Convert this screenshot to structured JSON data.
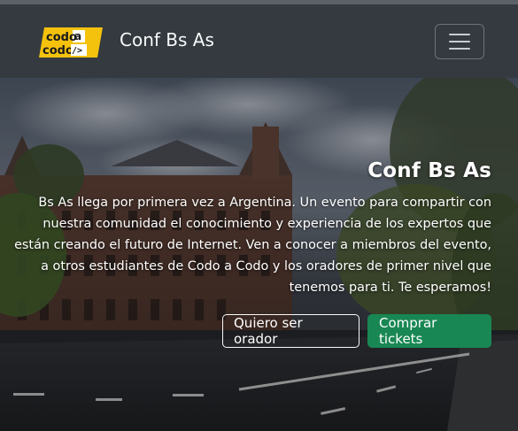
{
  "navbar": {
    "logo_line1": "codo",
    "logo_line1_accent": "a",
    "logo_line2": "codo",
    "logo_line2_accent": "/>",
    "brand": "Conf Bs As",
    "toggler_icon": "hamburger-icon"
  },
  "hero": {
    "title": "Conf Bs As",
    "text": "Bs As llega por primera vez a Argentina. Un evento para compartir con nuestra comunidad el conocimiento y experiencia de los expertos que están creando el futuro de Internet. Ven a conocer a miembros del evento, a otros estudiantes de Codo a Codo y los oradores de primer nivel que tenemos para ti. Te esperamos!",
    "btn_speaker": "Quiero ser orador",
    "btn_tickets": "Comprar tickets"
  },
  "colors": {
    "navbar_bg": "#343a40",
    "logo_yellow": "#f4c20d",
    "success": "#198754"
  }
}
